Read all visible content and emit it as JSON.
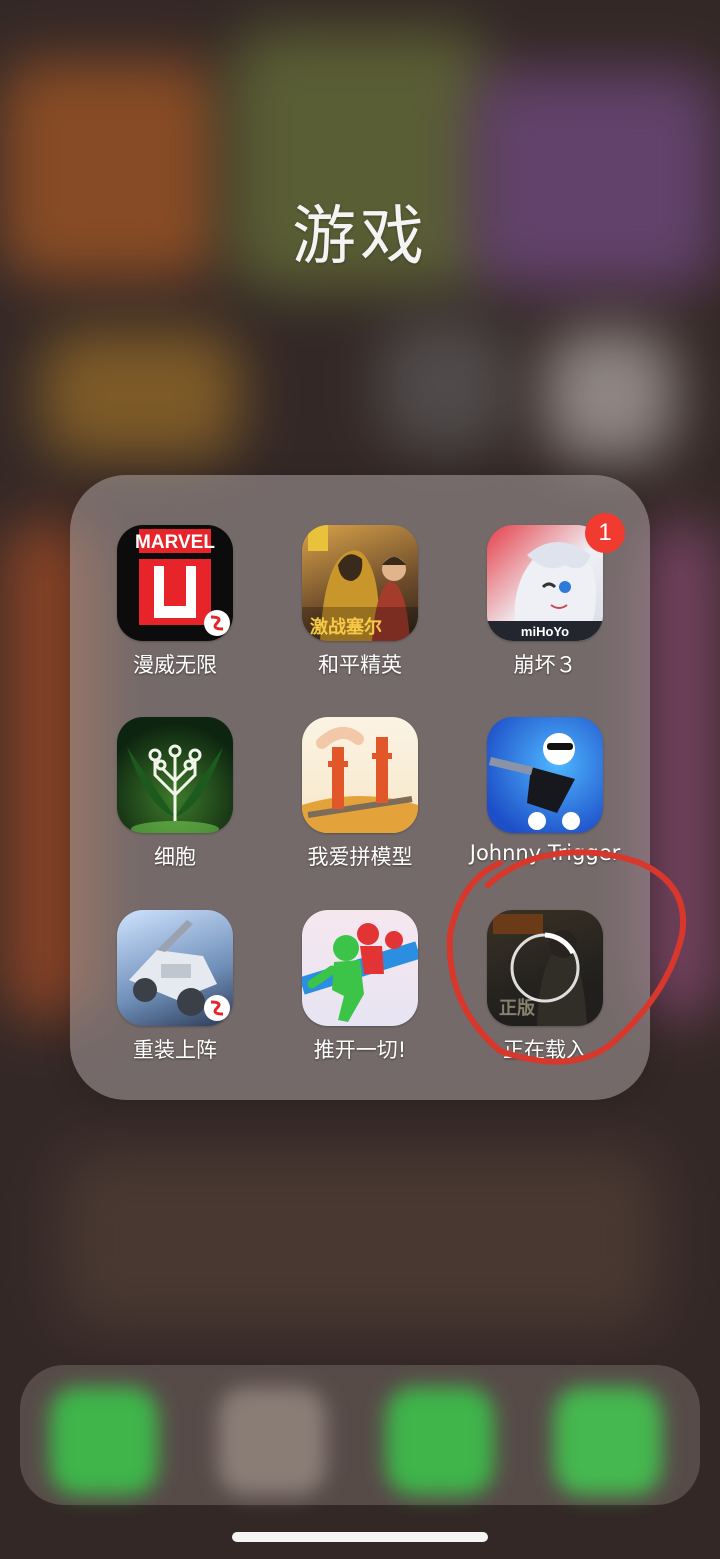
{
  "folder": {
    "title": "游戏",
    "apps": [
      {
        "label": "漫威无限",
        "icon": "marvel-unlimited-icon"
      },
      {
        "label": "和平精英",
        "icon": "peacekeeper-elite-icon",
        "icon_text": "激战塞尔"
      },
      {
        "label": "崩坏３",
        "icon": "honkai-impact-icon",
        "badge": "1",
        "icon_text": "miHoYo"
      },
      {
        "label": "细胞",
        "icon": "cell-to-singularity-icon"
      },
      {
        "label": "我爱拼模型",
        "icon": "bridge-model-icon"
      },
      {
        "label": "Johnny Trigger",
        "icon": "johnny-trigger-icon"
      },
      {
        "label": "重装上阵",
        "icon": "mech-vehicle-icon"
      },
      {
        "label": "推开一切!",
        "icon": "push-everything-icon"
      },
      {
        "label": "正在载入",
        "icon": "downloading-app-icon",
        "icon_text": "正版",
        "state": "downloading"
      }
    ]
  },
  "dock": {
    "apps": [
      {
        "icon": "phone-icon",
        "color": "#3fb54a"
      },
      {
        "icon": "contacts-icon",
        "color": "#8a7d76"
      },
      {
        "icon": "messages-icon",
        "color": "#3fb54a"
      },
      {
        "icon": "wechat-icon",
        "color": "#45b84f"
      }
    ]
  },
  "colors": {
    "badge": "#f13b30",
    "annotation": "#d8372c",
    "folder_bg": "rgba(170,160,160,0.55)"
  }
}
